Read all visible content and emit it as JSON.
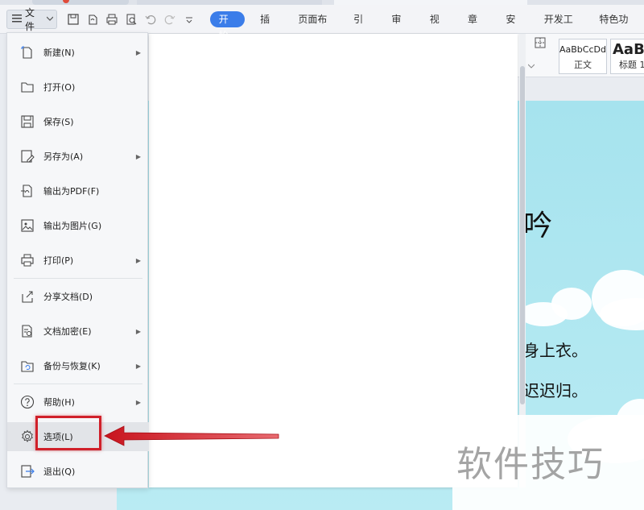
{
  "menubar": {
    "file_label": "文件",
    "tabs": [
      "开始",
      "插入",
      "页面布局",
      "引用",
      "审阅",
      "视图",
      "章节",
      "安全",
      "开发工具",
      "特色功能"
    ],
    "active_tab": "开始"
  },
  "ribbon": {
    "style1_sample": "AaBbCcDd",
    "style1_name": "正文",
    "style2_sample": "AaB",
    "style2_name": "标题 1"
  },
  "file_menu": {
    "items": [
      {
        "label": "新建(N)",
        "icon": "new-doc-icon",
        "has_submenu": true
      },
      {
        "label": "打开(O)",
        "icon": "folder-open-icon",
        "has_submenu": false
      },
      {
        "label": "保存(S)",
        "icon": "save-icon",
        "has_submenu": false
      },
      {
        "label": "另存为(A)",
        "icon": "save-as-icon",
        "has_submenu": true
      },
      {
        "label": "输出为PDF(F)",
        "icon": "export-pdf-icon",
        "has_submenu": false
      },
      {
        "label": "输出为图片(G)",
        "icon": "export-image-icon",
        "has_submenu": false
      },
      {
        "label": "打印(P)",
        "icon": "print-icon",
        "has_submenu": true
      },
      {
        "label": "分享文档(D)",
        "icon": "share-icon",
        "has_submenu": false
      },
      {
        "label": "文档加密(E)",
        "icon": "encrypt-icon",
        "has_submenu": true
      },
      {
        "label": "备份与恢复(K)",
        "icon": "backup-icon",
        "has_submenu": true
      },
      {
        "label": "帮助(H)",
        "icon": "help-icon",
        "has_submenu": true
      },
      {
        "label": "选项(L)",
        "icon": "gear-icon",
        "has_submenu": false
      },
      {
        "label": "退出(Q)",
        "icon": "exit-icon",
        "has_submenu": false
      }
    ],
    "highlighted": "选项(L)"
  },
  "document": {
    "line1": "吟",
    "line2": "身上衣。",
    "line3": "迟迟归。"
  },
  "watermark": "软件技巧",
  "colors": {
    "accent": "#3b7de9",
    "highlight_red": "#d0202a",
    "page_bg": "#a6e3ee"
  }
}
